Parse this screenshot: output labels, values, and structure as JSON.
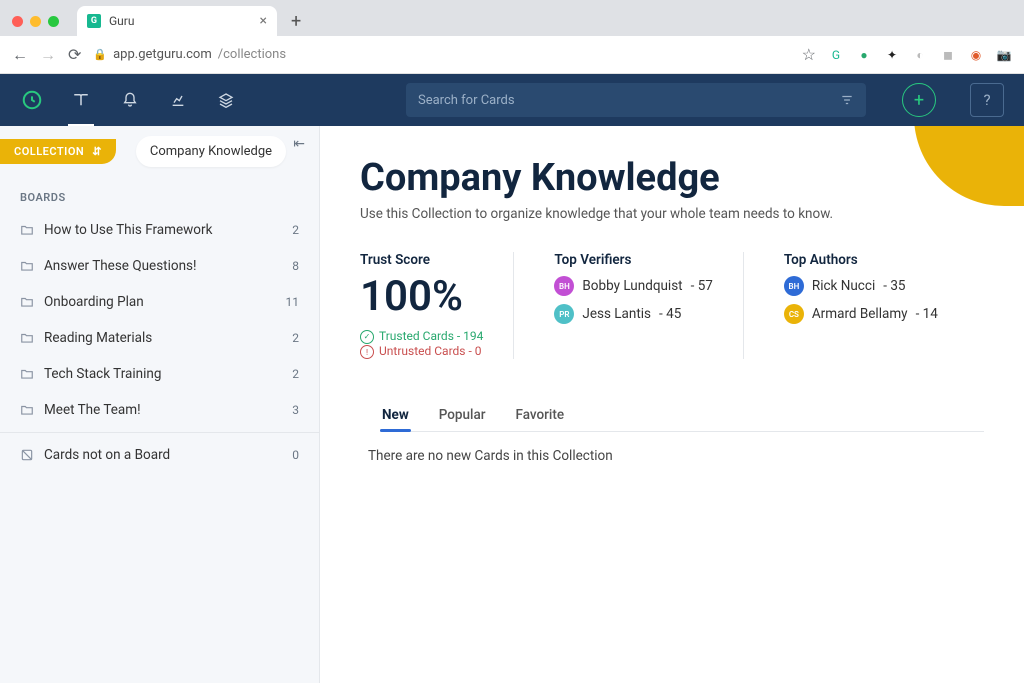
{
  "browser": {
    "tab_title": "Guru",
    "url_host": "app.getguru.com",
    "url_path": "/collections"
  },
  "header": {
    "search_placeholder": "Search for Cards",
    "help_label": "?"
  },
  "sidebar": {
    "collection_tab_label": "COLLECTION",
    "collection_name": "Company Knowledge",
    "boards_label": "BOARDS",
    "boards": [
      {
        "name": "How to Use This Framework",
        "count": 2
      },
      {
        "name": "Answer These Questions!",
        "count": 8
      },
      {
        "name": "Onboarding Plan",
        "count": 11
      },
      {
        "name": "Reading Materials",
        "count": 2
      },
      {
        "name": "Tech Stack Training",
        "count": 2
      },
      {
        "name": "Meet The Team!",
        "count": 3
      }
    ],
    "loose_cards": {
      "name": "Cards not on a Board",
      "count": 0
    }
  },
  "main": {
    "title": "Company Knowledge",
    "subtitle": "Use this Collection to organize knowledge that your whole team needs to know.",
    "trust": {
      "title": "Trust Score",
      "score": "100%",
      "trusted_label": "Trusted Cards - 194",
      "untrusted_label": "Untrusted Cards - 0"
    },
    "verifiers": {
      "title": "Top Verifiers",
      "people": [
        {
          "initials": "BH",
          "color": "#c24fd4",
          "name": "Bobby Lundquist",
          "count": 57
        },
        {
          "initials": "PR",
          "color": "#4fc0c7",
          "name": "Jess Lantis",
          "count": 45
        }
      ]
    },
    "authors": {
      "title": "Top Authors",
      "people": [
        {
          "initials": "BH",
          "color": "#2e6bd6",
          "name": "Rick Nucci",
          "count": 35
        },
        {
          "initials": "CS",
          "color": "#eab308",
          "name": "Armard Bellamy",
          "count": 14
        }
      ]
    },
    "tabs": [
      "New",
      "Popular",
      "Favorite"
    ],
    "active_tab": 0,
    "empty_message": "There are no new Cards in this Collection"
  }
}
